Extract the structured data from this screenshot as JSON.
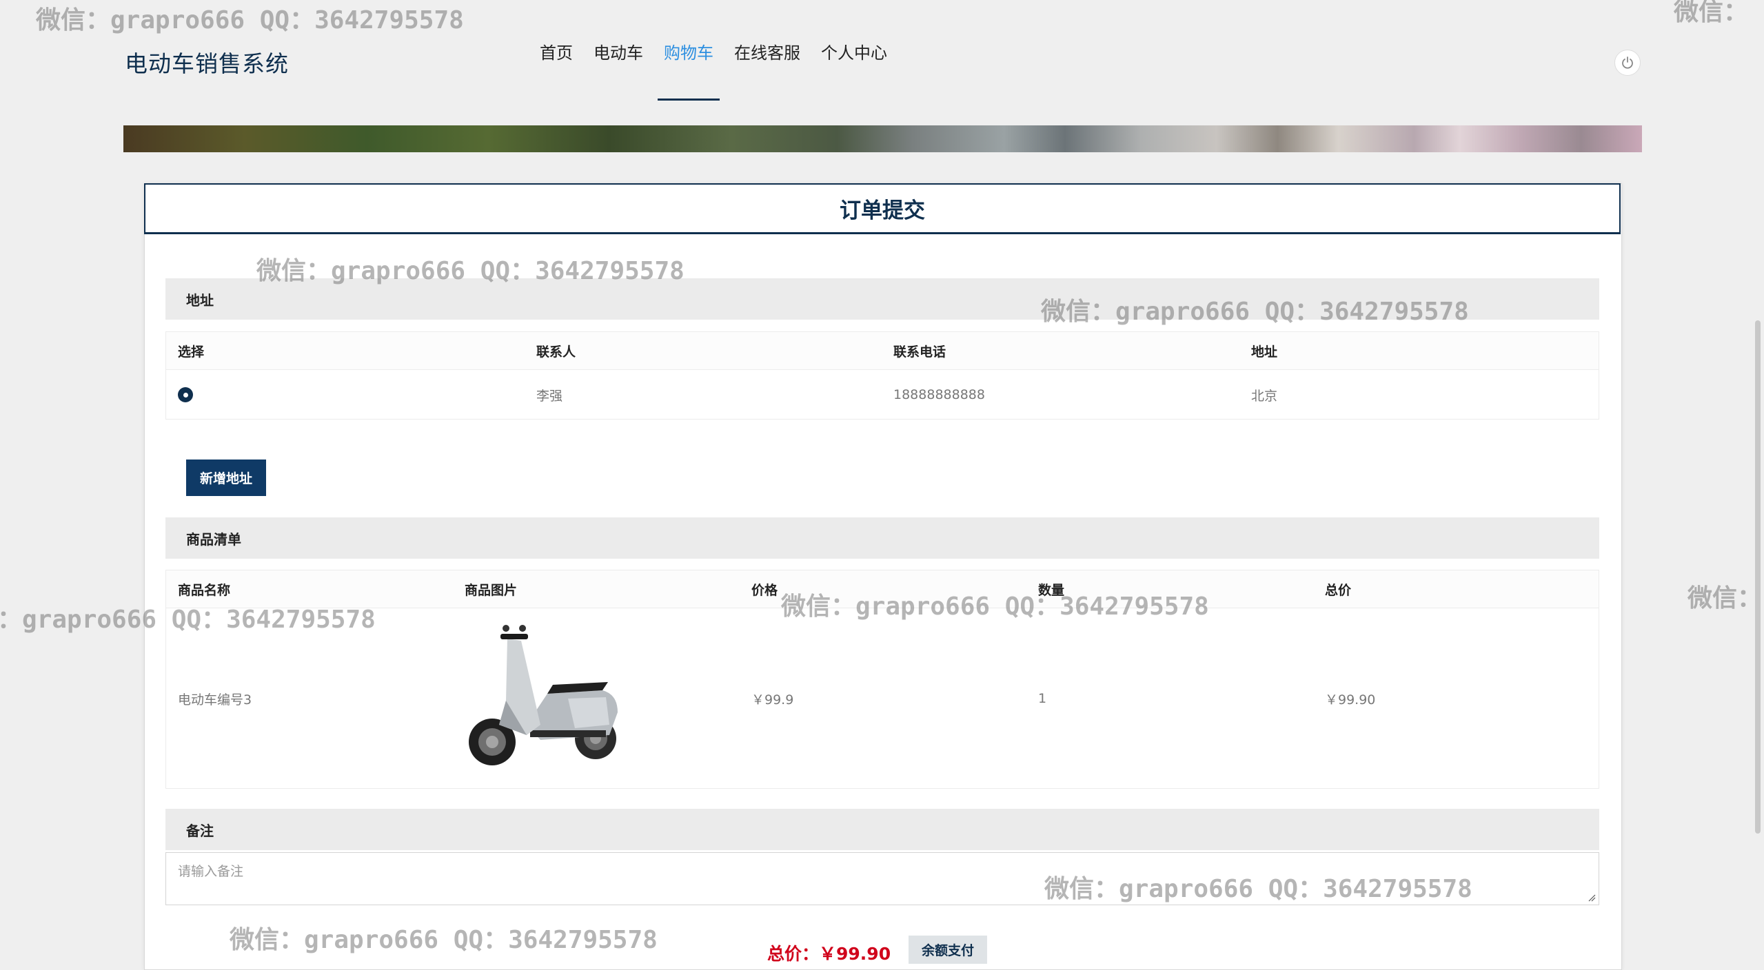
{
  "header": {
    "brand": "电动车销售系统",
    "nav": [
      "首页",
      "电动车",
      "购物车",
      "在线客服",
      "个人中心"
    ],
    "active_nav": "购物车"
  },
  "card_title": "订单提交",
  "address": {
    "section_label": "地址",
    "columns": [
      "选择",
      "联系人",
      "联系电话",
      "地址"
    ],
    "rows": [
      {
        "selected": true,
        "contact": "李强",
        "phone": "18888888888",
        "address": "北京"
      }
    ],
    "add_button": "新增地址"
  },
  "goods": {
    "section_label": "商品清单",
    "columns": [
      "商品名称",
      "商品图片",
      "价格",
      "数量",
      "总价"
    ],
    "rows": [
      {
        "name": "电动车编号3",
        "price": "￥99.9",
        "quantity": "1",
        "total": "￥99.90"
      }
    ]
  },
  "remark": {
    "section_label": "备注",
    "placeholder": "请输入备注"
  },
  "footer": {
    "total_label": "总价：",
    "total_value": "￥99.90",
    "pay_button": "余额支付"
  },
  "watermark_text": "微信：grapro666 QQ：3642795578",
  "watermark_partial": "微信：",
  "watermark_left_cut": "：grapro666 QQ：3642795578",
  "colors": {
    "primary": "#0f2f4e",
    "active_nav": "#2d8fe0",
    "price": "#d0021b"
  }
}
